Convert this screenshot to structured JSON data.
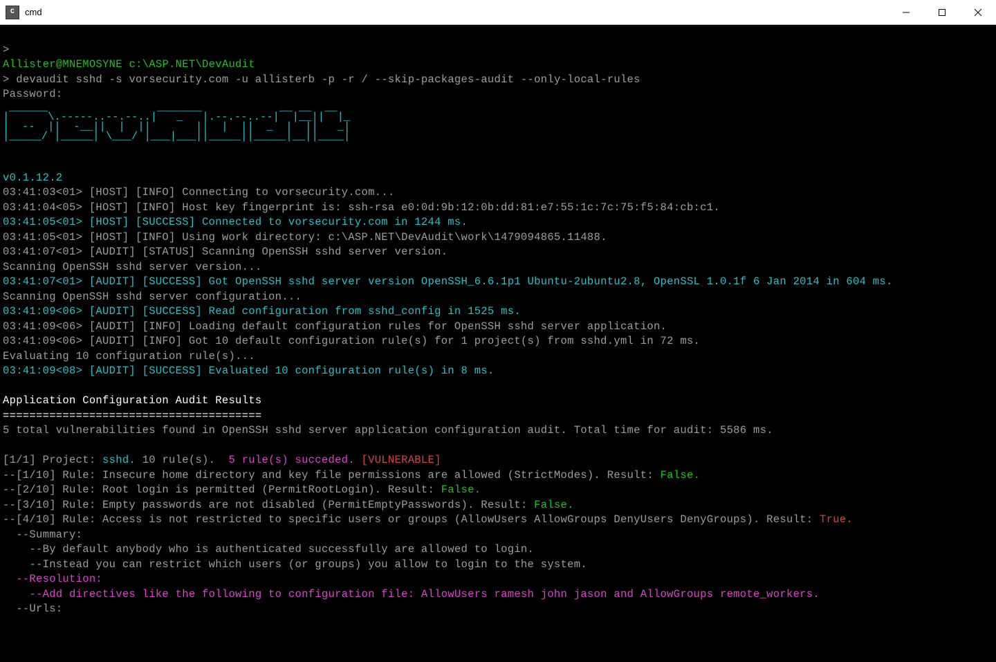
{
  "window": {
    "title": "cmd"
  },
  "prompt": {
    "userhost": "Allister@MNEMOSYNE",
    "path": "c:\\ASP.NET\\DevAudit",
    "caret1": ">",
    "command": "devaudit sshd -s vorsecurity.com -u allisterb -p -r / --skip-packages-audit --only-local-rules",
    "password_label": "Password:"
  },
  "ascii_art": " ______                 _______            __ __  __    \n|      \\.-----..--.--..|   _   |.--.--..--|  |__||  |_  \n|  --  ||  -__||  |  ||       ||  |  ||  _  |  ||   _| \n|_____/ |_____| \\___/ |___|___||_____||_____|__||____| ",
  "version": "v0.1.12.2",
  "log": [
    {
      "ts": "03:41:03<01>",
      "src": "[HOST]",
      "lvl": "[INFO]",
      "msg": "Connecting to vorsecurity.com...",
      "color": "gray"
    },
    {
      "ts": "03:41:04<05>",
      "src": "[HOST]",
      "lvl": "[INFO]",
      "msg": "Host key fingerprint is: ssh-rsa e0:0d:9b:12:0b:dd:81:e7:55:1c:7c:75:f5:84:cb:c1.",
      "color": "gray"
    },
    {
      "ts": "03:41:05<01>",
      "src": "[HOST]",
      "lvl": "[SUCCESS]",
      "msg": "Connected to vorsecurity.com in 1244 ms.",
      "color": "cyan"
    },
    {
      "ts": "03:41:05<01>",
      "src": "[HOST]",
      "lvl": "[INFO]",
      "msg": "Using work directory: c:\\ASP.NET\\DevAudit\\work\\1479094865.11488.",
      "color": "gray"
    },
    {
      "ts": "03:41:07<01>",
      "src": "[AUDIT]",
      "lvl": "[STATUS]",
      "msg": "Scanning OpenSSH sshd server version.",
      "color": "gray"
    }
  ],
  "plain1": "Scanning OpenSSH sshd server version...",
  "log2": [
    {
      "ts": "03:41:07<01>",
      "src": "[AUDIT]",
      "lvl": "[SUCCESS]",
      "msg": "Got OpenSSH sshd server version OpenSSH_6.6.1p1 Ubuntu-2ubuntu2.8, OpenSSL 1.0.1f 6 Jan 2014 in 604 ms.",
      "color": "cyan"
    }
  ],
  "plain2": "Scanning OpenSSH sshd server configuration...",
  "log3": [
    {
      "ts": "03:41:09<06>",
      "src": "[AUDIT]",
      "lvl": "[SUCCESS]",
      "msg": "Read configuration from sshd_config in 1525 ms.",
      "color": "cyan"
    },
    {
      "ts": "03:41:09<06>",
      "src": "[AUDIT]",
      "lvl": "[INFO]",
      "msg": "Loading default configuration rules for OpenSSH sshd server application.",
      "color": "gray"
    },
    {
      "ts": "03:41:09<06>",
      "src": "[AUDIT]",
      "lvl": "[INFO]",
      "msg": "Got 10 default configuration rule(s) for 1 project(s) from sshd.yml in 72 ms.",
      "color": "gray"
    }
  ],
  "plain3": "Evaluating 10 configuration rule(s)...",
  "log4": [
    {
      "ts": "03:41:09<08>",
      "src": "[AUDIT]",
      "lvl": "[SUCCESS]",
      "msg": "Evaluated 10 configuration rule(s) in 8 ms.",
      "color": "cyan"
    }
  ],
  "results": {
    "heading": "Application Configuration Audit Results",
    "divider": "=======================================",
    "summary": "5 total vulnerabilities found in OpenSSH sshd server application configuration audit. Total time for audit: 5586 ms.",
    "project_prefix": "[1/1] Project: ",
    "project_name": "sshd.",
    "rules_count": " 10 rule(s).  ",
    "succeeded": "5 rule(s) succeded. ",
    "vulnerable": "[VULNERABLE]"
  },
  "rules": [
    {
      "idx": "--[1/10]",
      "text": " Rule: Insecure home directory and key file permissions are allowed (StrictModes). Result: ",
      "result": "False.",
      "rcolor": "green"
    },
    {
      "idx": "--[2/10]",
      "text": " Rule: Root login is permitted (PermitRootLogin). Result: ",
      "result": "False.",
      "rcolor": "green"
    },
    {
      "idx": "--[3/10]",
      "text": " Rule: Empty passwords are not disabled (PermitEmptyPasswords). Result: ",
      "result": "False.",
      "rcolor": "green"
    },
    {
      "idx": "--[4/10]",
      "text": " Rule: Access is not restricted to specific users or groups (AllowUsers AllowGroups DenyUsers DenyGroups). Result: ",
      "result": "True.",
      "rcolor": "red"
    }
  ],
  "detail": {
    "summary_label": "  --Summary:",
    "summary_lines": [
      "    --By default anybody who is authenticated successfully are allowed to login.",
      "    --Instead you can restrict which users (or groups) you allow to login to the system."
    ],
    "resolution_label": "  --Resolution:",
    "resolution_lines": [
      "    --Add directives like the following to configuration file: AllowUsers ramesh john jason and AllowGroups remote_workers."
    ],
    "urls_label": "  --Urls:"
  }
}
